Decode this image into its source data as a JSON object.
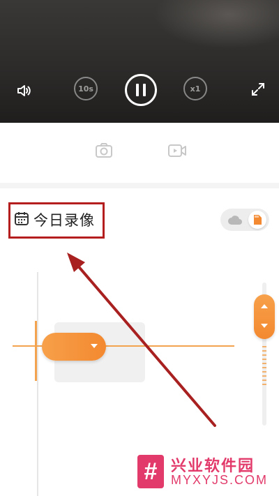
{
  "player": {
    "rewind_label": "10s",
    "speed_label": "x1",
    "icons": [
      "volume-icon",
      "rewind-10s-icon",
      "pause-icon",
      "speed-icon",
      "fullscreen-icon"
    ]
  },
  "tools": {
    "icons": [
      "snapshot-icon",
      "record-video-icon"
    ]
  },
  "header": {
    "title": "今日录像"
  },
  "storage_toggle": {
    "selected": "sd-card",
    "options": [
      "cloud",
      "sd-card"
    ]
  },
  "watermark": {
    "logo_glyph": "#",
    "name": "兴业软件园",
    "url": "MYXYJS.COM"
  },
  "colors": {
    "accent": "#f38930",
    "annotation": "#b51e1e",
    "watermark": "#e23a6a"
  }
}
